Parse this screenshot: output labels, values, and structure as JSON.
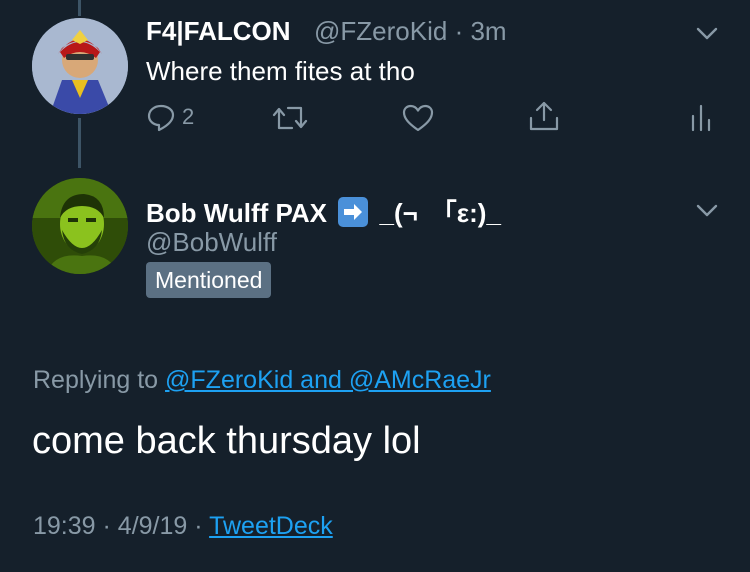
{
  "original_tweet": {
    "display_name": "F4|FALCON",
    "handle": "@FZeroKid",
    "separator": "·",
    "time": "3m",
    "text": "Where them fites at tho",
    "reply_count": "2"
  },
  "reply_author": {
    "display_name": "Bob Wulff PAX",
    "name_suffix": "_(¬　｢ε:)_",
    "handle": "@BobWulff",
    "badge": "Mentioned"
  },
  "reply": {
    "replying_prefix": "Replying to",
    "replying_to": "@FZeroKid and @AMcRaeJr",
    "text": "come back thursday lol",
    "time": "19:39",
    "date": "4/9/19",
    "separator": "·",
    "source": "TweetDeck"
  },
  "icons": [
    "reply-icon",
    "retweet-icon",
    "like-icon",
    "share-icon",
    "analytics-icon",
    "chevron-down-icon",
    "right-arrow-emoji-icon"
  ],
  "colors": {
    "background": "#15202b",
    "text": "#ffffff",
    "muted": "#8899a6",
    "link": "#1da1f2",
    "badge": "#5b7083"
  }
}
